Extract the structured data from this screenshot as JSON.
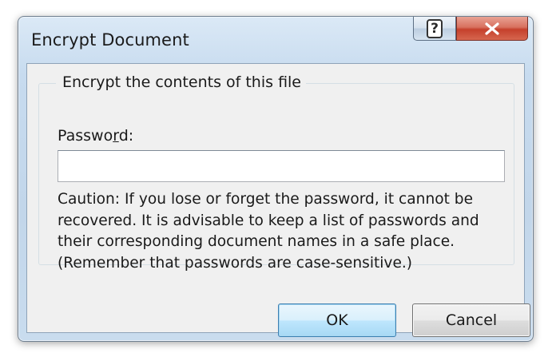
{
  "dialog": {
    "title": "Encrypt Document",
    "help_icon": "help-icon",
    "close_icon": "close-icon",
    "group_label": "Encrypt the contents of this file",
    "password_label_pre": "Passwo",
    "password_label_accel": "r",
    "password_label_post": "d:",
    "password_value": "",
    "caution_text": "Caution: If you lose or forget the password, it cannot be\nrecovered. It is advisable to keep a list of passwords and\ntheir corresponding document names in a safe place.\n(Remember that passwords are case-sensitive.)",
    "ok_label": "OK",
    "cancel_label": "Cancel"
  },
  "colors": {
    "frame": "#c7dbef",
    "close_button": "#c5402c",
    "default_button": "#bee6fd",
    "client_background": "#f0f0f0"
  }
}
